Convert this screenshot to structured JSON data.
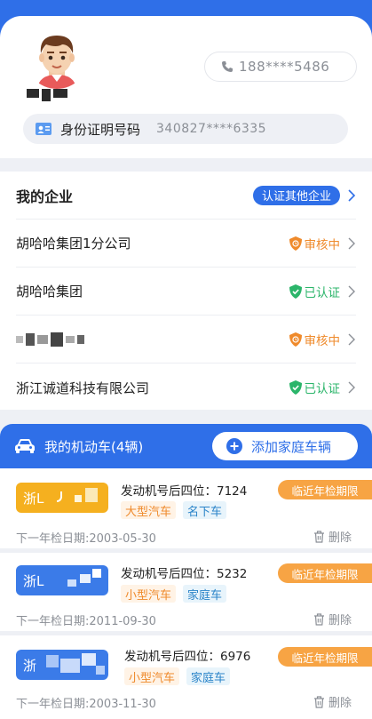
{
  "profile": {
    "phone": "188****5486",
    "id_label": "身份证明号码",
    "id_value": "340827****6335"
  },
  "companies": {
    "heading": "我的企业",
    "certify_other_label": "认证其他企业",
    "items": [
      {
        "name": "胡哈哈集团1分公司",
        "status": "审核中",
        "state": "pending"
      },
      {
        "name": "胡哈哈集团",
        "status": "已认证",
        "state": "verified"
      },
      {
        "name": "",
        "status": "审核中",
        "state": "pending"
      },
      {
        "name": "浙江诚道科技有限公司",
        "status": "已认证",
        "state": "verified"
      }
    ]
  },
  "vehicles": {
    "title": "我的机动车(4辆)",
    "add_label": "添加家庭车辆",
    "delete_label": "删除",
    "items": [
      {
        "plate_prefix": "浙L",
        "plate_color": "yellow",
        "engine": "发动机号后四位：7124",
        "tag1": "大型汽车",
        "tag2": "名下车",
        "deadline": "临近年检期限",
        "next_inspection": "下一年检日期:2003-05-30"
      },
      {
        "plate_prefix": "浙L",
        "plate_color": "blue",
        "engine": "发动机号后四位：5232",
        "tag1": "小型汽车",
        "tag2": "家庭车",
        "deadline": "临近年检期限",
        "next_inspection": "下一年检日期:2011-09-30"
      },
      {
        "plate_prefix": "浙",
        "plate_color": "blue",
        "engine": "发动机号后四位：6976",
        "tag1": "小型汽车",
        "tag2": "家庭车",
        "deadline": "临近年检期限",
        "next_inspection": "下一年检日期:2003-11-30"
      }
    ]
  },
  "colors": {
    "brand": "#2f6fe8",
    "pending": "#ef8a2b",
    "verified": "#2bb56a",
    "warning": "#f7a444"
  },
  "icons": [
    "avatar",
    "phone-icon",
    "id-card-icon",
    "chevron-right-icon",
    "shield-clock-icon",
    "shield-check-icon",
    "car-icon",
    "plus-circle-icon",
    "trash-icon"
  ]
}
